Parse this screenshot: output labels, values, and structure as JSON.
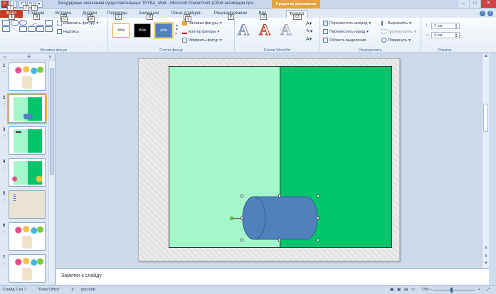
{
  "titlebar": {
    "title": "Безударные окончания существительных ТРУБА_Мой - Microsoft PowerPoint (Сбой активации про...",
    "context_tab_group": "Средства рисования",
    "qat_keytips": [
      "1",
      "2",
      "3"
    ]
  },
  "tabs": [
    {
      "label": "Файл",
      "keytip": "Ф"
    },
    {
      "label": "Главная",
      "keytip": "Я"
    },
    {
      "label": "Вставка",
      "keytip": "С"
    },
    {
      "label": "Дизайн",
      "keytip": "Л"
    },
    {
      "label": "Переходы",
      "keytip": "Х"
    },
    {
      "label": "Анимация",
      "keytip": "И"
    },
    {
      "label": "Показ слайдов",
      "keytip": "З"
    },
    {
      "label": "Рецензирование",
      "keytip": "Р"
    },
    {
      "label": "Вид",
      "keytip": "О"
    },
    {
      "label": "Формат",
      "keytip": "БТ"
    }
  ],
  "ribbon": {
    "insert_shapes": {
      "label": "Вставка фигур",
      "change_shape": "Изменить фигуру",
      "textbox": "Надпись"
    },
    "shape_styles": {
      "label": "Стили фигур",
      "thumbs": [
        "Абв",
        "Абв",
        "Абв"
      ],
      "fill": "Заливка фигуры",
      "outline": "Контур фигуры",
      "effects": "Эффекты фигур"
    },
    "wordart": {
      "label": "Стили WordArt",
      "letters": [
        "A",
        "A",
        "A"
      ]
    },
    "arrange": {
      "label": "Упорядочить",
      "bring_forward": "Переместить вперед",
      "send_backward": "Переместить назад",
      "selection_pane": "Область выделения",
      "align": "Выровнять",
      "group": "Группировать",
      "rotate": "Повернуть"
    },
    "size": {
      "label": "Размер",
      "height": "7 см",
      "width": "4 см"
    }
  },
  "slides_panel": {
    "slides": [
      {
        "num": "1",
        "star": "☆"
      },
      {
        "num": "2",
        "star": "☆"
      },
      {
        "num": "3",
        "star": "☆"
      },
      {
        "num": "4",
        "star": "☆"
      },
      {
        "num": "5",
        "star": "☆"
      },
      {
        "num": "6",
        "star": "☆"
      },
      {
        "num": "7",
        "star": "☆"
      }
    ]
  },
  "notes": {
    "placeholder": "Заметки к слайду"
  },
  "statusbar": {
    "slide_info": "Слайд 2 из 7",
    "theme": "\"Тема Office\"",
    "language": "русский",
    "zoom": "73%"
  },
  "colors": {
    "panel_light": "#a4f7cb",
    "panel_dark": "#00c56a",
    "cylinder_fill": "#4f81bd",
    "file_tab": "#c23b22",
    "context_tab": "#e8a23d"
  }
}
